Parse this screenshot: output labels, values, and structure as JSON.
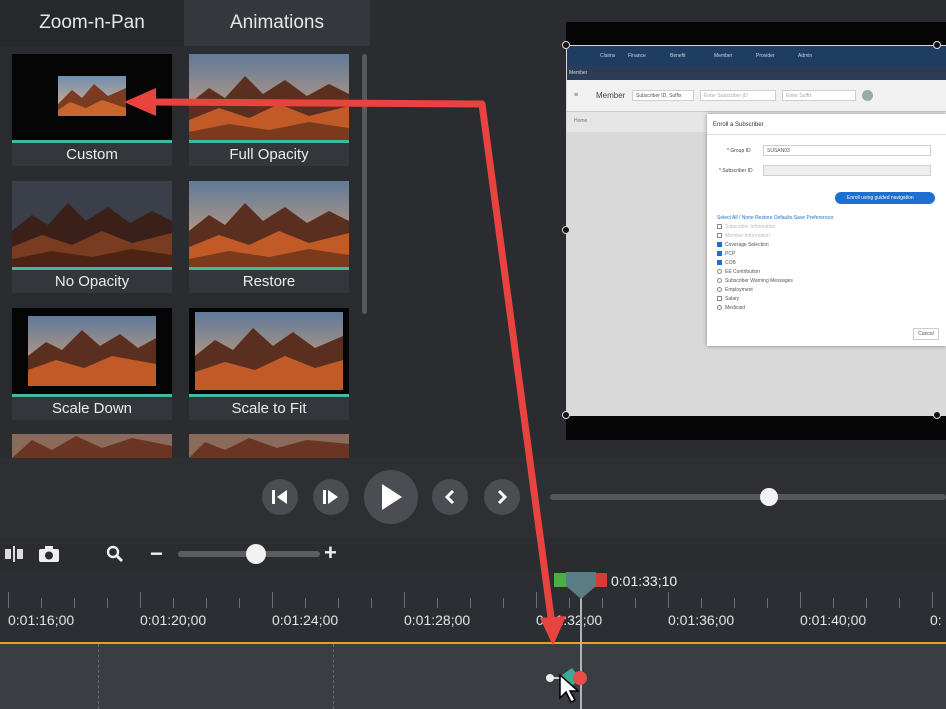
{
  "tabs": [
    {
      "label": "Zoom-n-Pan",
      "active": false
    },
    {
      "label": "Animations",
      "active": true
    }
  ],
  "animations": [
    {
      "label": "Custom"
    },
    {
      "label": "Full Opacity"
    },
    {
      "label": "No Opacity"
    },
    {
      "label": "Restore"
    },
    {
      "label": "Scale Down"
    },
    {
      "label": "Scale to Fit"
    }
  ],
  "preview": {
    "navbar": [
      "Claims",
      "Finance",
      "Benefit",
      "Member",
      "Provider",
      "Admin"
    ],
    "member_tab": "Member",
    "filter_label": "Member",
    "filter_select": "Subscriber ID, Suffix",
    "filter_input1": "Enter Subscriber ID",
    "filter_input2": "Enter Suffix",
    "home": "Home",
    "modal": {
      "title": "Enroll a Subscriber",
      "group_label": "* Group ID",
      "group_value": "SUSAN03",
      "subscriber_label": "* Subscriber ID",
      "guided_button": "Enroll using guided navigation",
      "select_links": "Select  All  /  None   Restore Defaults   Save Preferences",
      "options": [
        {
          "label": "Subscriber Information",
          "state": "dim"
        },
        {
          "label": "Member Information",
          "state": "dim"
        },
        {
          "label": "Coverage Selection",
          "state": "on"
        },
        {
          "label": "PCP",
          "state": "on"
        },
        {
          "label": "COB",
          "state": "on"
        },
        {
          "label": "EE Contribution",
          "state": "off"
        },
        {
          "label": "Subscriber Warning Messages",
          "state": "off"
        },
        {
          "label": "Employment",
          "state": "off"
        },
        {
          "label": "Salary",
          "state": "off"
        },
        {
          "label": "Medicaid",
          "state": "off"
        }
      ],
      "cancel": "Cancel"
    }
  },
  "playback": {
    "icons": [
      "step-back-icon",
      "step-forward-icon",
      "play-icon",
      "previous-icon",
      "next-icon"
    ],
    "scrub_position": 0.55
  },
  "timeline": {
    "zoom_minus": "−",
    "zoom_plus": "+",
    "zoom_level": 0.55,
    "playhead_time": "0:01:33;10",
    "labels": [
      "0:01:16;00",
      "0:01:20;00",
      "0:01:24;00",
      "0:01:28;00",
      "0:01:32;00",
      "0:01:36;00",
      "0:01:40;00",
      "0:"
    ]
  },
  "colors": {
    "accent": "#3fb9a4",
    "arrow": "#e9433f",
    "track_line": "#e5a02c",
    "playhead": "#5a7c84"
  }
}
